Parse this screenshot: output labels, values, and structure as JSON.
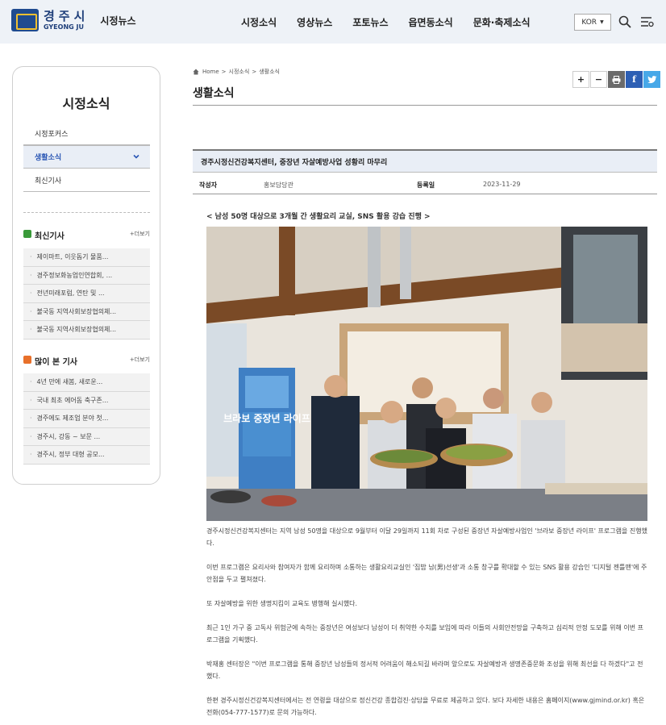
{
  "header": {
    "logo_ko": "경주시",
    "logo_en": "GYEONG JU",
    "section": "시정뉴스",
    "nav": [
      "시정소식",
      "영상뉴스",
      "포토뉴스",
      "읍면동소식",
      "문화·축제소식"
    ],
    "lang": "KOR"
  },
  "sidebar": {
    "title": "시정소식",
    "menu": [
      "시정포커스",
      "생활소식",
      "최신기사"
    ],
    "latest": {
      "title": "최신기사",
      "more": "+더보기",
      "items": [
        "제이마트, 이웃돕기 물품...",
        "경주정보화농업인연합회, ...",
        "전년미래포럼, 연탄 및 ...",
        "불국동 지역사회보장협의체...",
        "불국동 지역사회보장협의체..."
      ]
    },
    "popular": {
      "title": "많이 본 기사",
      "more": "+더보기",
      "items": [
        "4년 만에 새봄, 새로운...",
        "국내 최초 에어돔 축구존...",
        "경주에도 제조업 분야 첫...",
        "경주시, 강동 ~ 보문 ...",
        "경주시, 정부 대형 공모..."
      ]
    }
  },
  "breadcrumb": [
    "Home",
    ">",
    "시정소식",
    ">",
    "생활소식"
  ],
  "tools": {
    "plus": "+",
    "minus": "−",
    "fb": "f"
  },
  "page_title": "생활소식",
  "article": {
    "title": "경주시정신건강복지센터, 중장년 자살예방사업 성황리 마무리",
    "author_label": "작성자",
    "author": "홍보담당관",
    "date_label": "등록일",
    "date": "2023-11-29",
    "subhead": "< 남성 50명 대상으로 3개월 간 생활요리 교실, SNS 활용 강습 진행 >",
    "banner_text": "브라보 중장년 라이프",
    "paragraphs": [
      "경주시정신건강복지센터는 지역 남성 50명을 대상으로 9월부터 이달 29일까지 11회 차로 구성된 중장년 자살예방사업인 '브라보 중장년 라이프' 프로그램을 진행했다.",
      "이번 프로그램은 요리사와 참여자가 함께 요리하며 소통하는 생활요리교실인 '집밥 남(男)선생'과 소통 창구를 확대할 수 있는 SNS 활용 강습인 '디지털 젠틀맨'에 주안점을 두고 펼쳐졌다.",
      "또 자살예방을 위한 생명지킴이 교육도 병행해 실시했다.",
      "최근 1인 가구 중 고독사 위험군에 속하는 중장년은 여성보다 남성이 더 취약한 수치를 보임에 따라 이들의 사회안전망을 구축하고 심리적 안정 도모를 위해 이번 프로그램을 기획했다.",
      "박재홍 센터장은 \"이번 프로그램을 통해 중장년 남성들의 정서적 어려움이 해소되길 바라며 앞으로도 자살예방과 생명존중문화 조성을 위해 최선을 다 하겠다\"고 전했다.",
      "한편 경주시정신건강복지센터에서는 전 연령을 대상으로 정신건강 종합검진·상담을 무료로 제공하고 있다. 보다 자세한 내용은 홈페이지(www.gjmind.or.kr) 혹은 전화(054-777-1577)로 문의 가능하다."
    ]
  },
  "colors": {
    "accent": "#2a56b4",
    "header_bg": "#eef2f7",
    "badge_green": "#3a9a3a",
    "badge_orange": "#e8702a"
  }
}
